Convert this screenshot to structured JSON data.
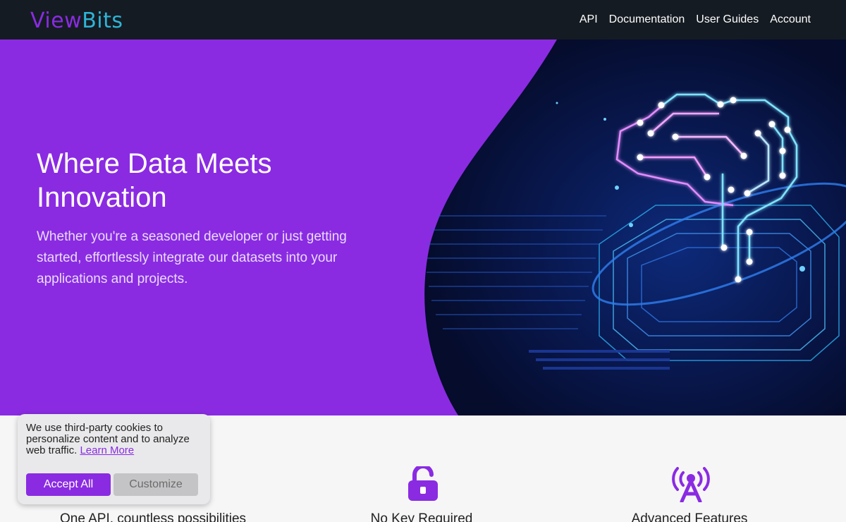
{
  "nav": {
    "logo_part1": "View",
    "logo_part2": "Bits",
    "links": [
      "API",
      "Documentation",
      "User Guides",
      "Account"
    ]
  },
  "hero": {
    "title": "Where Data Meets Innovation",
    "subtitle": "Whether you're a seasoned developer or just getting started, effortlessly integrate our datasets into your applications and projects."
  },
  "features": [
    {
      "label": "One API, countless possibilities",
      "icon": "api-icon"
    },
    {
      "label": "No Key Required",
      "icon": "unlock-icon"
    },
    {
      "label": "Advanced Features",
      "icon": "broadcast-tower-icon"
    }
  ],
  "cookie": {
    "text": "We use third-party cookies to personalize content and to analyze web traffic.",
    "learn_more": "Learn More",
    "accept_label": "Accept All",
    "customize_label": "Customize"
  },
  "colors": {
    "brand_purple": "#8a2be2",
    "brand_cyan": "#2fb4d6",
    "nav_bg": "#151b22"
  }
}
